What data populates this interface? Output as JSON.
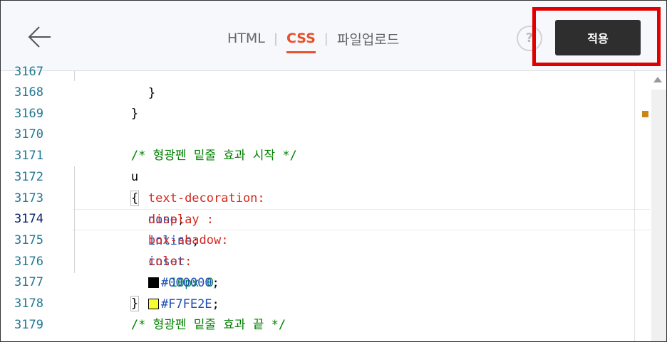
{
  "header": {
    "tabs": [
      {
        "label": "HTML",
        "active": false
      },
      {
        "label": "CSS",
        "active": true
      },
      {
        "label": "파일업로드",
        "active": false
      }
    ],
    "tab_separator": "|",
    "help_label": "?",
    "apply_label": "적용",
    "colors": {
      "active_tab": "#e8512a",
      "apply_bg": "#2e2e2e",
      "highlight": "#e00000"
    }
  },
  "editor": {
    "line_numbers": [
      "3167",
      "3168",
      "3169",
      "3170",
      "3171",
      "3172",
      "3173",
      "3174",
      "3175",
      "3176",
      "3177",
      "3178",
      "3179"
    ],
    "current_line": "3174",
    "lines": {
      "l3167": "}",
      "l3168": "}",
      "l3170": "/* 형광펜 밑줄 효과 시작 */",
      "l3171_sel": "u",
      "l3171_brace": "{",
      "l3172_prop": "text-decoration:",
      "l3172_val": "none",
      "l3172_end": ";",
      "l3173_prop": "display :",
      "l3173_val": "inline",
      "l3173_end": ";",
      "l3174_prop": "box-shadow:",
      "l3174_val": "inset",
      "l3174_nums": "0 -10px 0",
      "l3174_color": "#F7FE2E",
      "l3174_end": ";",
      "l3175_prop": "color:",
      "l3175_color": "#000000",
      "l3175_end": ";",
      "l3177": "}",
      "l3178": "/* 형광펜 밑줄 효과 끝 */"
    },
    "swatches": {
      "yellow": "#F7FE2E",
      "black": "#000000"
    }
  }
}
